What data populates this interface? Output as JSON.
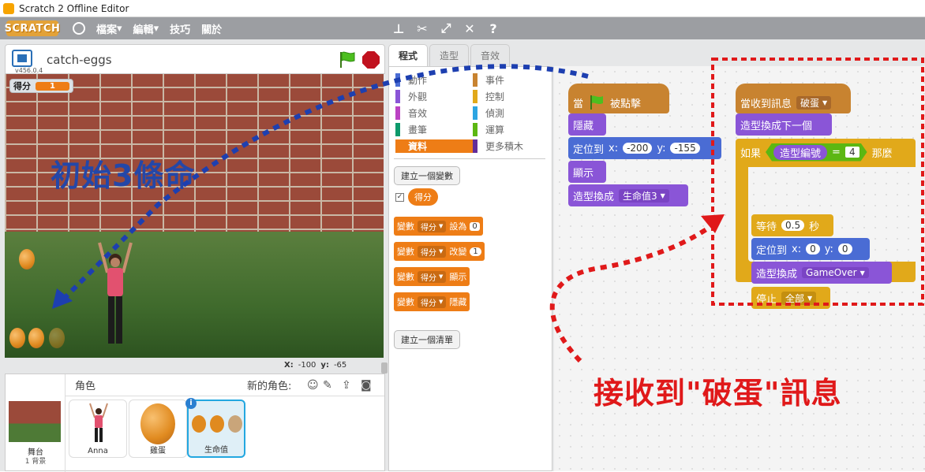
{
  "window": {
    "title": "Scratch 2 Offline Editor"
  },
  "menu": {
    "logo": "SCRATCH",
    "items": [
      {
        "label": "檔案",
        "dropdown": true
      },
      {
        "label": "編輯",
        "dropdown": true
      },
      {
        "label": "技巧",
        "dropdown": false
      },
      {
        "label": "關於",
        "dropdown": false
      }
    ],
    "tool_icons": [
      "stamp-icon",
      "cut-icon",
      "grow-icon",
      "shrink-icon",
      "help-icon"
    ]
  },
  "stage": {
    "project_name": "catch-eggs",
    "version": "v456.0.4",
    "variable_monitor": {
      "label": "得分",
      "value": "1"
    },
    "overlay_text": "初始3條命",
    "coords": {
      "x_label": "X:",
      "x": "-100",
      "y_label": "y:",
      "y": "-65"
    }
  },
  "sprites_pane": {
    "title": "角色",
    "new_sprite_label": "新的角色:",
    "stage_item": {
      "name": "舞台",
      "sub": "1 背景"
    },
    "sprites": [
      {
        "name": "Anna",
        "selected": false
      },
      {
        "name": "雞蛋",
        "selected": false
      },
      {
        "name": "生命值",
        "selected": true
      }
    ]
  },
  "tabs": [
    {
      "label": "程式",
      "active": true
    },
    {
      "label": "造型",
      "active": false
    },
    {
      "label": "音效",
      "active": false
    }
  ],
  "palette": {
    "categories": [
      {
        "label": "動作",
        "color": "#4a6cd4",
        "active": false
      },
      {
        "label": "事件",
        "color": "#c88330",
        "active": false
      },
      {
        "label": "外觀",
        "color": "#8a55d7",
        "active": false
      },
      {
        "label": "控制",
        "color": "#e1a91a",
        "active": false
      },
      {
        "label": "音效",
        "color": "#bb42c3",
        "active": false
      },
      {
        "label": "偵測",
        "color": "#2ca5e2",
        "active": false
      },
      {
        "label": "畫筆",
        "color": "#0e9a6c",
        "active": false
      },
      {
        "label": "運算",
        "color": "#5cb712",
        "active": false
      },
      {
        "label": "資料",
        "color": "#ee7d16",
        "active": true
      },
      {
        "label": "更多積木",
        "color": "#632d99",
        "active": false
      }
    ],
    "make_variable": "建立一個變數",
    "variable_reporter": "得分",
    "blocks": [
      {
        "prefix": "變數",
        "var": "得分",
        "action": "設為",
        "value": "0"
      },
      {
        "prefix": "變數",
        "var": "得分",
        "action": "改變",
        "value": "1"
      },
      {
        "prefix": "變數",
        "var": "得分",
        "action": "顯示",
        "value": ""
      },
      {
        "prefix": "變數",
        "var": "得分",
        "action": "隱藏",
        "value": ""
      }
    ],
    "make_list": "建立一個清單"
  },
  "script1": {
    "hat": {
      "when": "當",
      "clicked": "被點擊"
    },
    "hide": "隱藏",
    "goto": {
      "label": "定位到",
      "x_label": "x:",
      "x": "-200",
      "y_label": "y:",
      "y": "-155"
    },
    "show": "顯示",
    "switch": {
      "label": "造型換成",
      "value": "生命值3"
    }
  },
  "script2": {
    "hat": {
      "label": "當收到訊息",
      "message": "破蛋"
    },
    "next_costume": "造型換成下一個",
    "if": {
      "label": "如果",
      "reporter": "造型編號",
      "op": "=",
      "value": "4",
      "then": "那麼"
    },
    "wait": {
      "label": "等待",
      "value": "0.5",
      "unit": "秒"
    },
    "goto": {
      "label": "定位到",
      "x_label": "x:",
      "x": "0",
      "y_label": "y:",
      "y": "0"
    },
    "switch": {
      "label": "造型換成",
      "value": "GameOver"
    },
    "stop": {
      "label": "停止",
      "value": "全部"
    }
  },
  "annotation_red": "接收到\"破蛋\"訊息",
  "colors": {
    "menubar": "#9c9ea2",
    "data": "#ee7d16",
    "control": "#e1a91a",
    "looks": "#8a55d7",
    "motion": "#4a6cd4",
    "events": "#c88330",
    "sensing": "#2ca5e2",
    "operators": "#5cb712",
    "annotation_blue": "#2447a8",
    "annotation_red": "#e0191a"
  }
}
